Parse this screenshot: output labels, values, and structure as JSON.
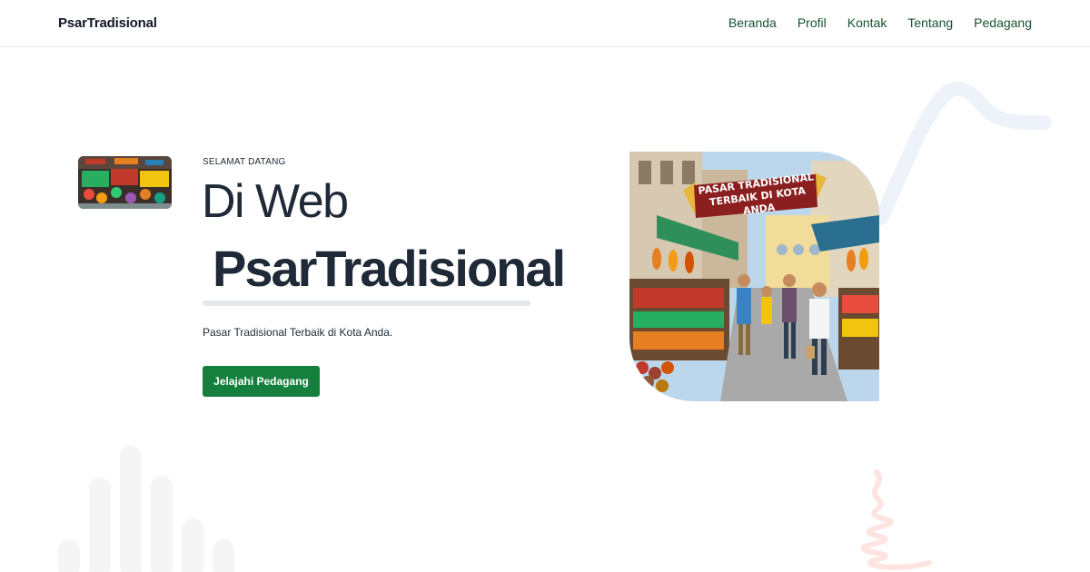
{
  "brand": {
    "name": "PsarTradisional"
  },
  "nav": {
    "items": [
      {
        "label": "Beranda"
      },
      {
        "label": "Profil"
      },
      {
        "label": "Kontak"
      },
      {
        "label": "Tentang"
      },
      {
        "label": "Pedagang"
      }
    ]
  },
  "hero": {
    "eyebrow": "SELAMAT DATANG",
    "title_line1": "Di Web",
    "title_line2": "PsarTradisional",
    "subtitle": "Pasar Tradisional Terbaik di Kota Anda.",
    "cta_label": "Jelajahi Pedagang",
    "image_banner": {
      "line1": "PASAR TRADISIONAL",
      "line2": "TERBAIK DI KOTA ANDA"
    }
  },
  "colors": {
    "accent": "#15803d",
    "nav_link": "#14532d",
    "text": "#1f2937"
  },
  "icons": {
    "thumbnail": "market-stall-thumbnail",
    "hero": "market-street-illustration"
  }
}
